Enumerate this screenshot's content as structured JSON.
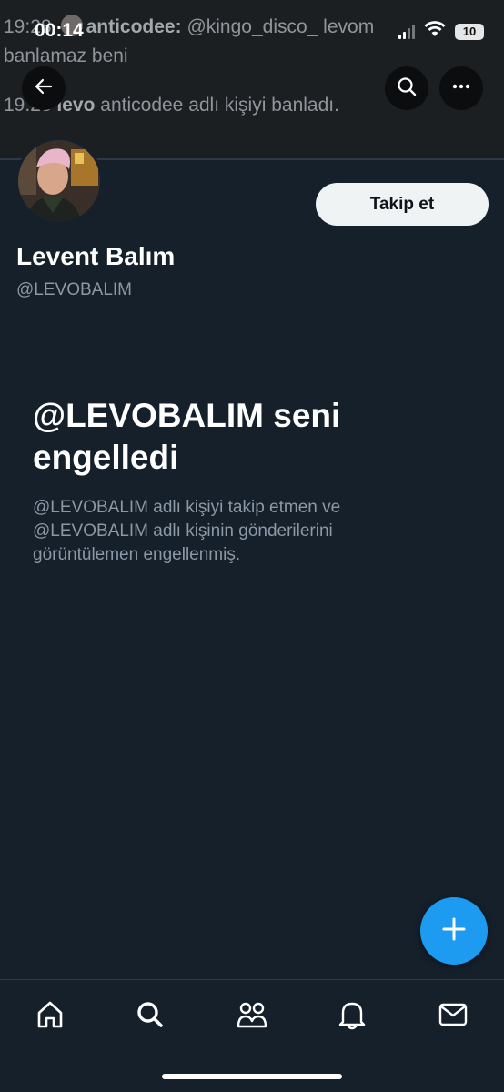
{
  "status_bar": {
    "time": "00:14",
    "battery": "10"
  },
  "banner": {
    "line1_time": "19:28",
    "line1_user": "anticodee:",
    "line1_text": "@kingo_disco_ levom",
    "line2_text": "banlamaz beni",
    "line3_time": "19.28",
    "line3_user": "levo",
    "line3_text": "anticodee adlı kişiyi banladı."
  },
  "profile": {
    "display_name": "Levent Balım",
    "handle": "@LEVOBALIM",
    "follow_label": "Takip et"
  },
  "blocked": {
    "title": "@LEVOBALIM seni engelledi",
    "description": "@LEVOBALIM adlı kişiyi takip etmen ve @LEVOBALIM adlı kişinin gönderilerini görüntülemen engellenmiş."
  },
  "icons": {
    "back": "arrow-left-icon",
    "search": "search-icon",
    "more": "more-horizontal-icon",
    "fab": "plus-icon",
    "nav": [
      "home-icon",
      "search-icon",
      "communities-icon",
      "bell-icon",
      "mail-icon"
    ]
  },
  "colors": {
    "background": "#15202b",
    "accent": "#1d9bf0",
    "secondary_text": "#8b98a5",
    "follow_button_bg": "#eff3f4"
  }
}
